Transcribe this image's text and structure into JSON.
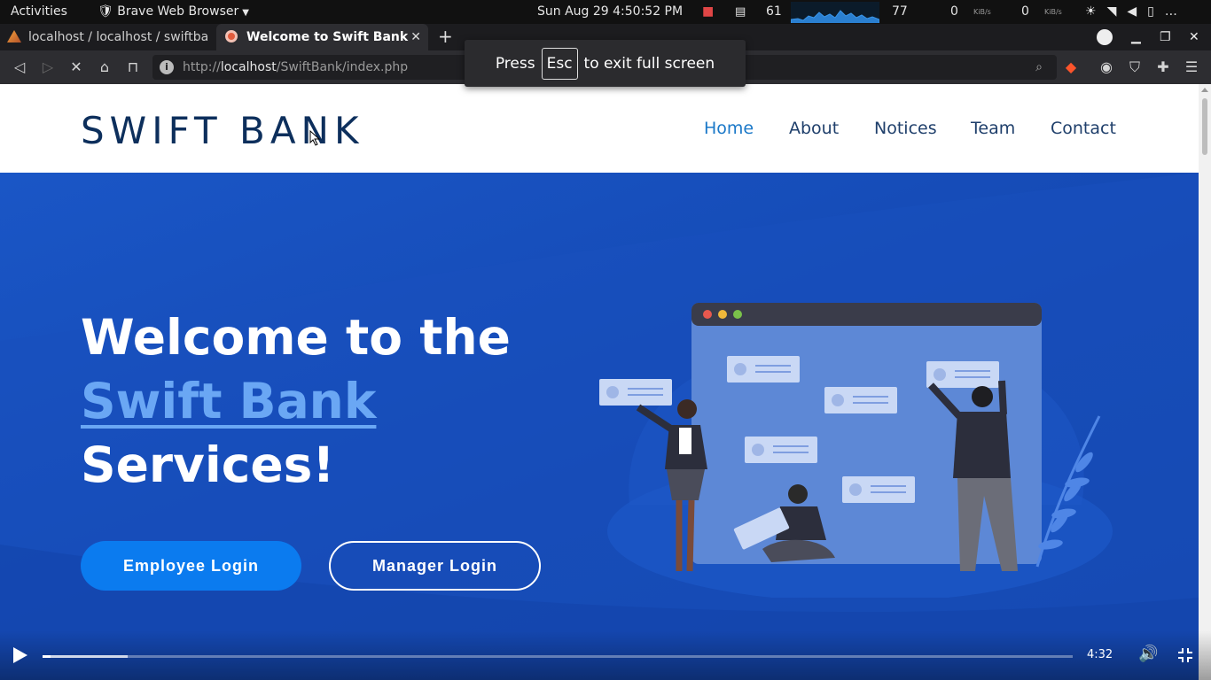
{
  "system_bar": {
    "activities": "Activities",
    "app_name": "Brave Web Browser",
    "clock": "Sun Aug 29   4:50:52 PM",
    "cpu": "61",
    "mem": "77",
    "net_down": "0",
    "net_up": "0",
    "net_unit": "KiB/s"
  },
  "tabs": [
    {
      "title": "localhost / localhost / swiftba"
    },
    {
      "title": "Welcome to Swift Bank"
    }
  ],
  "address": {
    "url_prefix": "http://",
    "url_host": "localhost",
    "url_path": "/SwiftBank/index.php"
  },
  "fullscreen_toast": {
    "press": "Press",
    "key": "Esc",
    "rest": "to exit full screen"
  },
  "site": {
    "logo": "SWIFT BANK",
    "nav": [
      {
        "label": "Home",
        "active": true
      },
      {
        "label": "About"
      },
      {
        "label": "Notices"
      },
      {
        "label": "Team"
      },
      {
        "label": "Contact"
      }
    ],
    "hero": {
      "line1": "Welcome to the",
      "line2": "Swift Bank",
      "line3": "Services!",
      "employee_btn": "Employee Login",
      "manager_btn": "Manager Login"
    }
  },
  "video": {
    "time": "4:32",
    "progress": 0.008,
    "buffered": 0.083
  },
  "colors": {
    "hero_bg": "#1549b8",
    "accent": "#0b7bef",
    "highlight": "#6aa7f4",
    "logo": "#0d2f5c"
  }
}
